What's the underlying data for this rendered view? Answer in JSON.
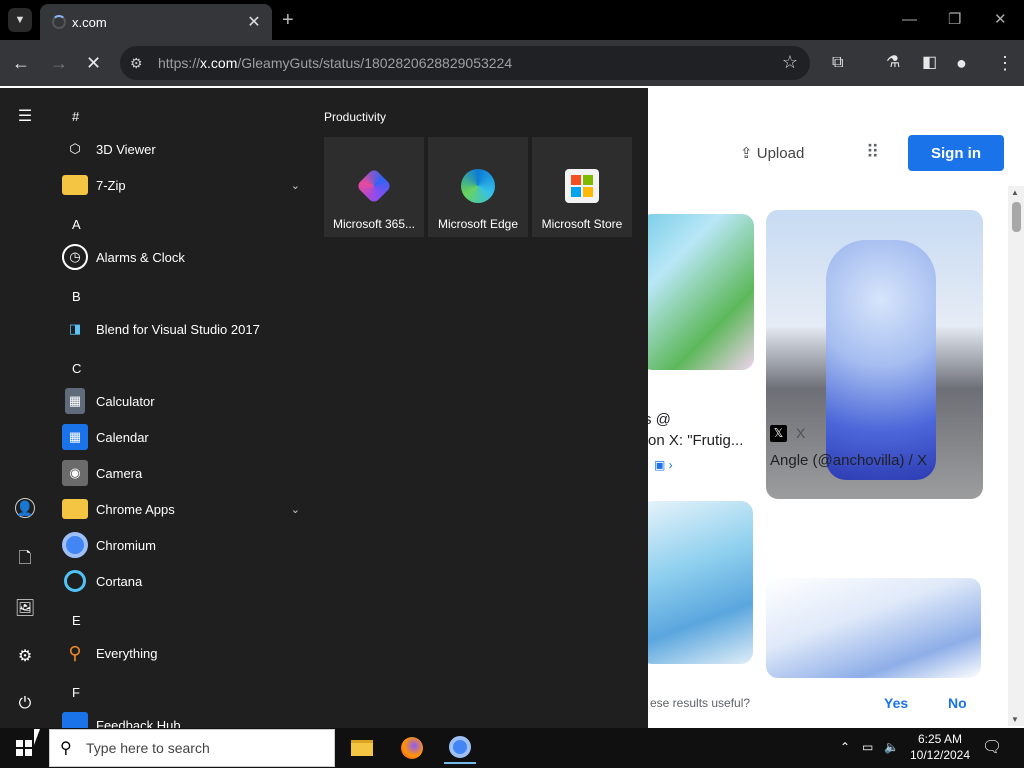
{
  "browser": {
    "tab_title": "x.com",
    "url_prefix": "https://",
    "url_host": "x.com",
    "url_path": "/GleamyGuts/status/1802820628829053224"
  },
  "page": {
    "upload_label": "Upload",
    "signin_label": "Sign in",
    "caption1_line1": "s @",
    "caption1_line2": "on X: \"Frutig...",
    "caption2_source": "X",
    "caption2_title": "Angle (@anchovilla) / X",
    "feedback_text": "ese results useful?",
    "feedback_yes": "Yes",
    "feedback_no": "No"
  },
  "start_menu": {
    "letters": [
      "#",
      "A",
      "B",
      "C",
      "E",
      "F"
    ],
    "apps": [
      {
        "label": "3D Viewer"
      },
      {
        "label": "7-Zip"
      },
      {
        "label": "Alarms & Clock"
      },
      {
        "label": "Blend for Visual Studio 2017"
      },
      {
        "label": "Calculator"
      },
      {
        "label": "Calendar"
      },
      {
        "label": "Camera"
      },
      {
        "label": "Chrome Apps"
      },
      {
        "label": "Chromium"
      },
      {
        "label": "Cortana"
      },
      {
        "label": "Everything"
      },
      {
        "label": "Feedback Hub"
      }
    ],
    "section_title": "Productivity",
    "tiles": [
      {
        "label": "Microsoft 365..."
      },
      {
        "label": "Microsoft Edge"
      },
      {
        "label": "Microsoft Store"
      }
    ]
  },
  "taskbar": {
    "search_placeholder": "Type here to search",
    "time": "6:25 AM",
    "date": "10/12/2024"
  },
  "colors": {
    "signin_blue": "#1a73e8",
    "start_bg": "#1f1f1f",
    "taskbar_bg": "#101010"
  }
}
